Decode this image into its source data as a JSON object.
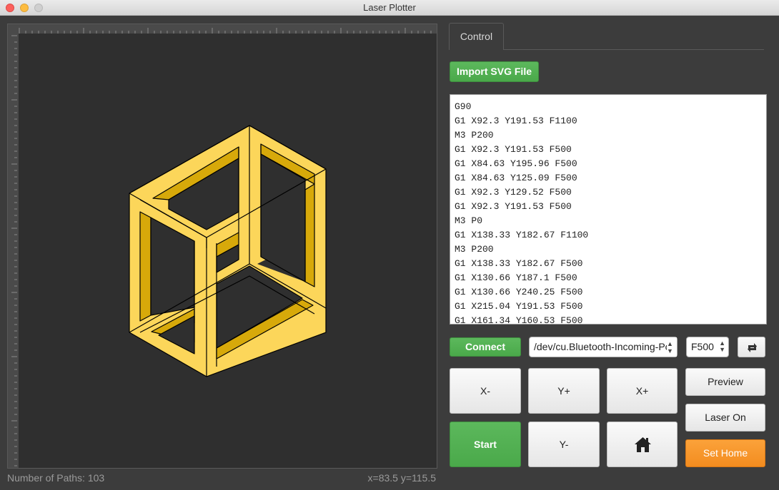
{
  "window": {
    "title": "Laser Plotter"
  },
  "status": {
    "paths": "Number of Paths: 103",
    "coords": "x=83.5 y=115.5"
  },
  "tabs": [
    {
      "label": "Control"
    }
  ],
  "import_button": "Import SVG File",
  "gcode_lines": [
    "G90",
    "G1 X92.3 Y191.53 F1100",
    "M3 P200",
    "G1 X92.3 Y191.53 F500",
    "G1 X84.63 Y195.96 F500",
    "G1 X84.63 Y125.09 F500",
    "G1 X92.3 Y129.52 F500",
    "G1 X92.3 Y191.53 F500",
    "M3 P0",
    "G1 X138.33 Y182.67 F1100",
    "M3 P200",
    "G1 X138.33 Y182.67 F500",
    "G1 X130.66 Y187.1 F500",
    "G1 X130.66 Y240.25 F500",
    "G1 X215.04 Y191.53 F500",
    "G1 X161.34 Y160.53 F500"
  ],
  "connect_button": "Connect",
  "port_select": "/dev/cu.Bluetooth-Incoming-Port",
  "feed_select": "F500",
  "jog": {
    "x_minus": "X-",
    "y_plus": "Y+",
    "x_plus": "X+",
    "y_minus": "Y-"
  },
  "start_button": "Start",
  "preview_button": "Preview",
  "laser_button": "Laser On",
  "sethome_button": "Set Home",
  "colors": {
    "shape_fill": "#fcd65a",
    "shape_inner": "#d7a90a",
    "accent_green": "#4cae4c",
    "accent_orange": "#f7941d"
  },
  "icons": [
    "refresh-icon",
    "home-icon"
  ]
}
